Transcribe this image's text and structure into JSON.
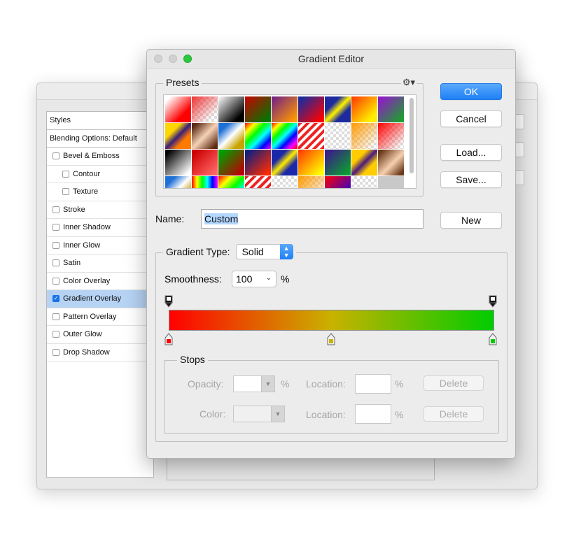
{
  "styles_panel": {
    "header": "Styles",
    "blending": "Blending Options: Default",
    "items": [
      {
        "label": "Bevel & Emboss",
        "checked": false,
        "sub": false
      },
      {
        "label": "Contour",
        "checked": false,
        "sub": true
      },
      {
        "label": "Texture",
        "checked": false,
        "sub": true
      },
      {
        "label": "Stroke",
        "checked": false,
        "sub": false
      },
      {
        "label": "Inner Shadow",
        "checked": false,
        "sub": false
      },
      {
        "label": "Inner Glow",
        "checked": false,
        "sub": false
      },
      {
        "label": "Satin",
        "checked": false,
        "sub": false
      },
      {
        "label": "Color Overlay",
        "checked": false,
        "sub": false
      },
      {
        "label": "Gradient Overlay",
        "checked": true,
        "sub": false,
        "selected": true
      },
      {
        "label": "Pattern Overlay",
        "checked": false,
        "sub": false
      },
      {
        "label": "Outer Glow",
        "checked": false,
        "sub": false
      },
      {
        "label": "Drop Shadow",
        "checked": false,
        "sub": false
      }
    ]
  },
  "dialog": {
    "title": "Gradient Editor",
    "presets_label": "Presets",
    "buttons": {
      "ok": "OK",
      "cancel": "Cancel",
      "load": "Load...",
      "save": "Save...",
      "new": "New"
    },
    "name_label": "Name:",
    "name_value": "Custom",
    "gradient_type_label": "Gradient Type:",
    "gradient_type_value": "Solid",
    "smoothness_label": "Smoothness:",
    "smoothness_value": "100",
    "percent": "%",
    "gradient_colors": {
      "left": "#ff0000",
      "middle": "#c9b200",
      "right": "#00cc00"
    },
    "stops": {
      "label": "Stops",
      "opacity_label": "Opacity:",
      "color_label": "Color:",
      "location_label": "Location:",
      "percent": "%",
      "delete_label": "Delete"
    }
  }
}
